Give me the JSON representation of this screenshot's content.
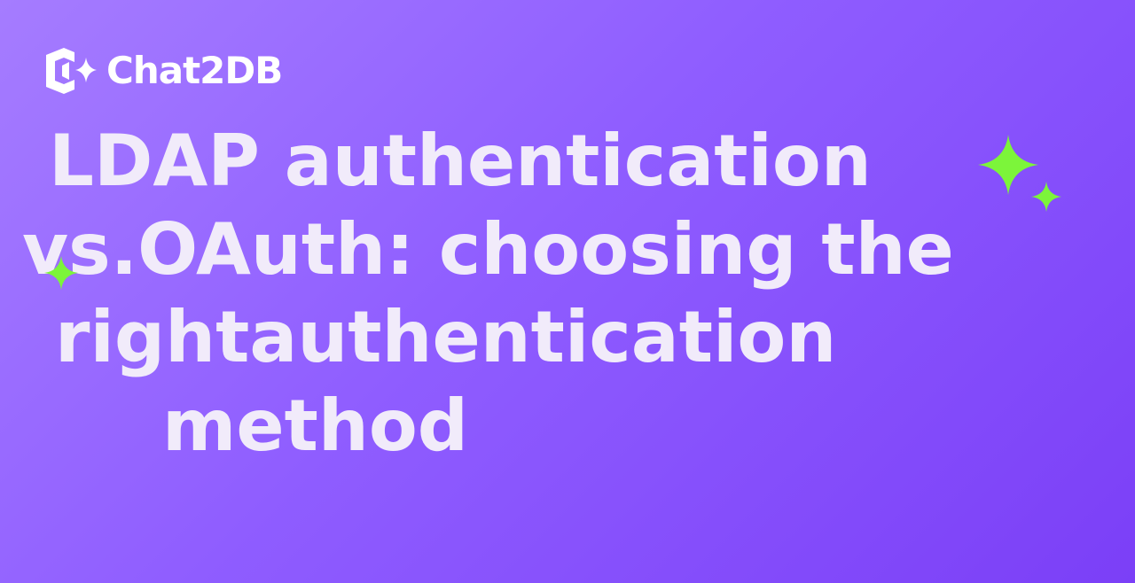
{
  "brand": {
    "name": "Chat2DB",
    "logo_icon": "chat2db-logo-icon"
  },
  "headline": {
    "lines": [
      "LDAP authentication",
      "vs.OAuth: choosing the",
      "rightauthentication",
      "method"
    ]
  },
  "decorations": {
    "sparkle_icon": "sparkle-icon",
    "sparkle_color": "#7cf53a"
  },
  "colors": {
    "background_start": "#a57cff",
    "background_end": "#7b3ff7",
    "headline_text": "#f1ebfa",
    "logo_text": "#ffffff"
  }
}
